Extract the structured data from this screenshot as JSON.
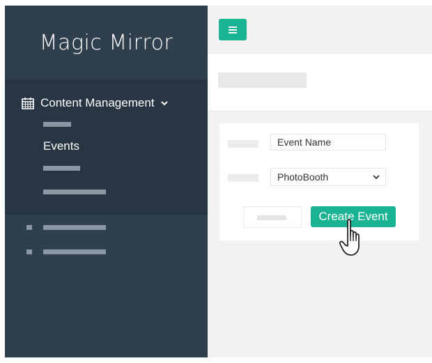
{
  "sidebar": {
    "brand": "Magic Mirror",
    "menu": {
      "label": "Content Management",
      "icon": "calendar-icon",
      "expanded": true,
      "active_item": "Events"
    }
  },
  "toolbar": {
    "menu_icon": "hamburger-menu-icon"
  },
  "form": {
    "event_name_value": "Event Name",
    "template_selected": "PhotoBooth",
    "submit_label": "Create Event"
  },
  "colors": {
    "sidebar_bg": "#2f3f4e",
    "sidebar_menu_bg": "#283644",
    "accent": "#1ab394",
    "content_bg": "#f2f2f2"
  }
}
